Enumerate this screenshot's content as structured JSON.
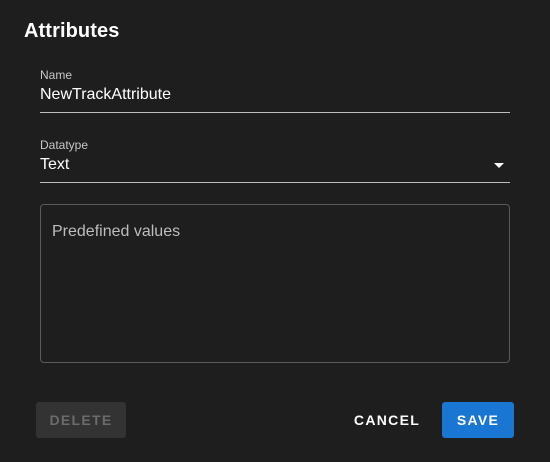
{
  "dialog": {
    "title": "Attributes"
  },
  "name_field": {
    "label": "Name",
    "value": "NewTrackAttribute"
  },
  "datatype_field": {
    "label": "Datatype",
    "selected": "Text",
    "icon": "dropdown-arrow-icon"
  },
  "predefined_values": {
    "placeholder": "Predefined values"
  },
  "actions": {
    "delete_label": "DELETE",
    "cancel_label": "CANCEL",
    "save_label": "SAVE"
  },
  "colors": {
    "background": "#1e1e1e",
    "primary": "#1976d2",
    "disabled_bg": "#333333",
    "disabled_text": "#6b6b6b"
  }
}
